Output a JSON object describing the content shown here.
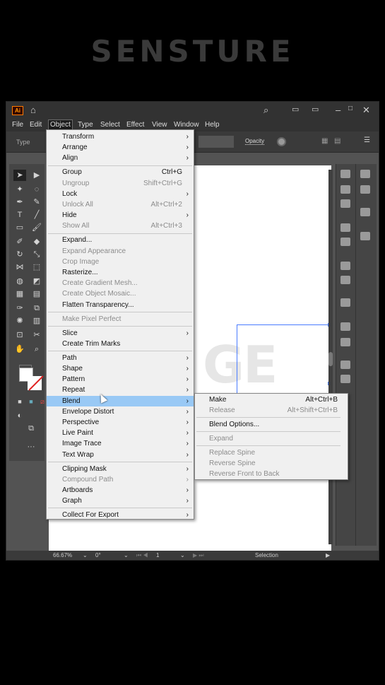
{
  "brand": "SENSTURE",
  "app": {
    "logo": "Ai",
    "menubar": [
      "File",
      "Edit",
      "Object",
      "Type",
      "Select",
      "Effect",
      "View",
      "Window",
      "Help"
    ],
    "control_label": "Type",
    "opacity_label": "Opacity",
    "status": {
      "zoom": "66.67%",
      "rotation": "0°",
      "artboard": "1",
      "tool": "Selection"
    },
    "canvas_text": {
      "ghost": "GE",
      "main": "GE"
    }
  },
  "object_menu": [
    {
      "label": "Transform",
      "submenu": true
    },
    {
      "label": "Arrange",
      "submenu": true
    },
    {
      "label": "Align",
      "submenu": true
    },
    {
      "sep": true
    },
    {
      "label": "Group",
      "shortcut": "Ctrl+G"
    },
    {
      "label": "Ungroup",
      "shortcut": "Shift+Ctrl+G",
      "disabled": true
    },
    {
      "label": "Lock",
      "submenu": true
    },
    {
      "label": "Unlock All",
      "shortcut": "Alt+Ctrl+2",
      "disabled": true
    },
    {
      "label": "Hide",
      "submenu": true
    },
    {
      "label": "Show All",
      "shortcut": "Alt+Ctrl+3",
      "disabled": true
    },
    {
      "sep": true
    },
    {
      "label": "Expand..."
    },
    {
      "label": "Expand Appearance",
      "disabled": true
    },
    {
      "label": "Crop Image",
      "disabled": true
    },
    {
      "label": "Rasterize..."
    },
    {
      "label": "Create Gradient Mesh...",
      "disabled": true
    },
    {
      "label": "Create Object Mosaic...",
      "disabled": true
    },
    {
      "label": "Flatten Transparency..."
    },
    {
      "sep": true
    },
    {
      "label": "Make Pixel Perfect",
      "disabled": true
    },
    {
      "sep": true
    },
    {
      "label": "Slice",
      "submenu": true
    },
    {
      "label": "Create Trim Marks"
    },
    {
      "sep": true
    },
    {
      "label": "Path",
      "submenu": true
    },
    {
      "label": "Shape",
      "submenu": true
    },
    {
      "label": "Pattern",
      "submenu": true
    },
    {
      "label": "Repeat",
      "submenu": true
    },
    {
      "label": "Blend",
      "submenu": true,
      "highlighted": true
    },
    {
      "label": "Envelope Distort",
      "submenu": true
    },
    {
      "label": "Perspective",
      "submenu": true
    },
    {
      "label": "Live Paint",
      "submenu": true
    },
    {
      "label": "Image Trace",
      "submenu": true
    },
    {
      "label": "Text Wrap",
      "submenu": true
    },
    {
      "sep": true
    },
    {
      "label": "Clipping Mask",
      "submenu": true
    },
    {
      "label": "Compound Path",
      "submenu": true,
      "disabled": true
    },
    {
      "label": "Artboards",
      "submenu": true
    },
    {
      "label": "Graph",
      "submenu": true
    },
    {
      "sep": true
    },
    {
      "label": "Collect For Export",
      "submenu": true
    }
  ],
  "blend_submenu": [
    {
      "label": "Make",
      "shortcut": "Alt+Ctrl+B"
    },
    {
      "label": "Release",
      "shortcut": "Alt+Shift+Ctrl+B",
      "disabled": true
    },
    {
      "sep": true
    },
    {
      "label": "Blend Options..."
    },
    {
      "sep": true
    },
    {
      "label": "Expand",
      "disabled": true
    },
    {
      "sep": true
    },
    {
      "label": "Replace Spine",
      "disabled": true
    },
    {
      "label": "Reverse Spine",
      "disabled": true
    },
    {
      "label": "Reverse Front to Back",
      "disabled": true
    }
  ],
  "colors": {
    "highlight": "#99c9f5",
    "menu_bg": "#f0f0f0",
    "ui_dark": "#323232",
    "ui_mid": "#535353"
  }
}
